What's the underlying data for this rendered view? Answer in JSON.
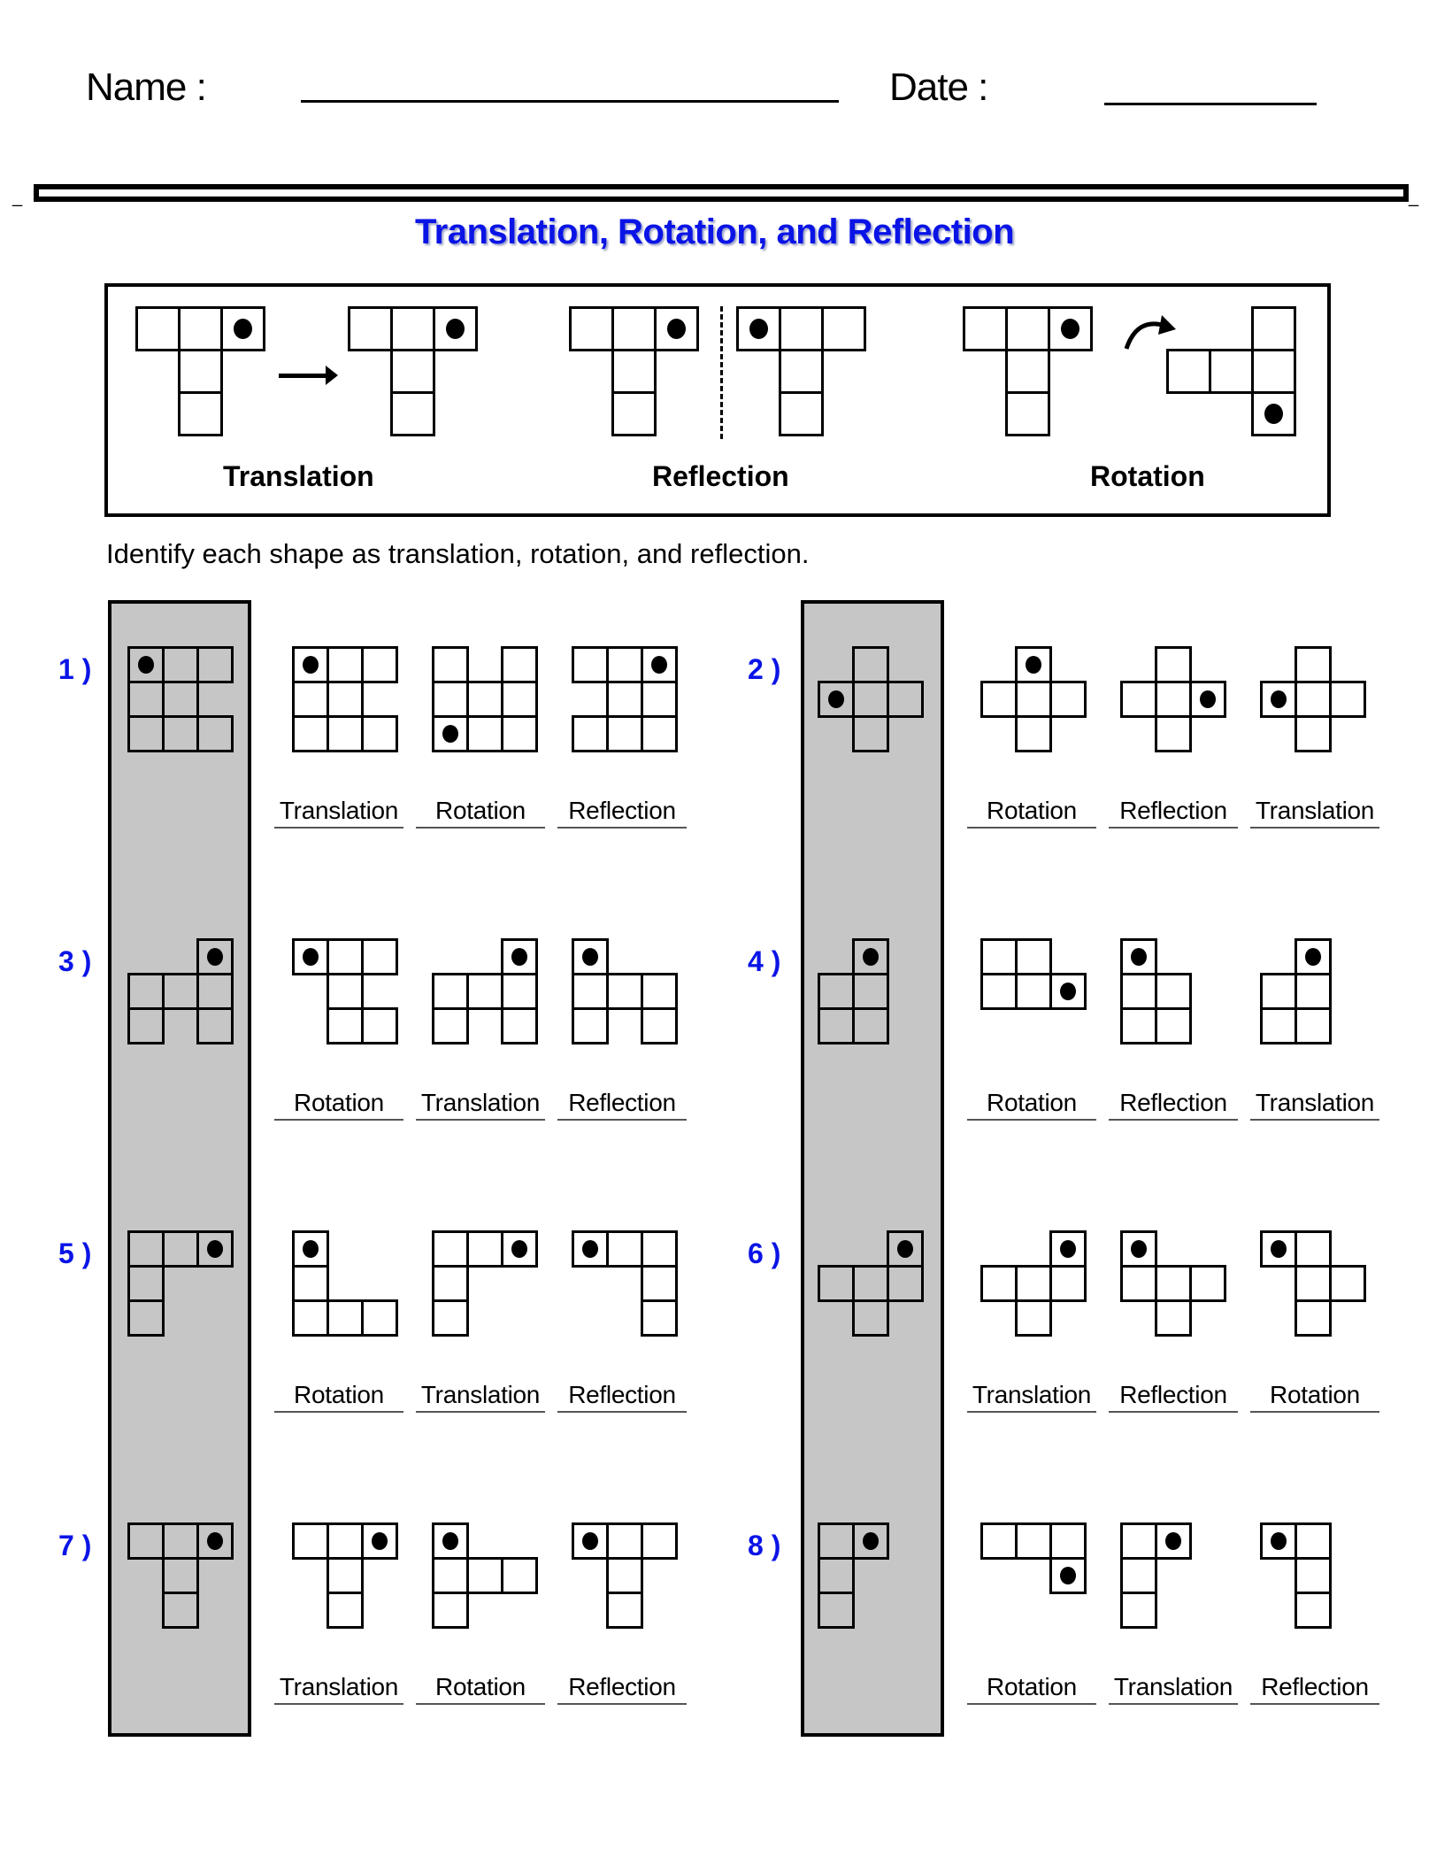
{
  "header": {
    "name_label": "Name :",
    "date_label": "Date :"
  },
  "title": "Translation, Rotation, and Reflection",
  "examples": {
    "translation_label": "Translation",
    "reflection_label": "Reflection",
    "rotation_label": "Rotation"
  },
  "instruction": "Identify each shape as translation, rotation, and reflection.",
  "colors": {
    "accent_blue": "#0a14e6",
    "panel_gray": "#c6c6c6"
  },
  "problems": [
    {
      "number": "1 )",
      "original": {
        "cells": [
          [
            0,
            0
          ],
          [
            0,
            1
          ],
          [
            0,
            2
          ],
          [
            1,
            0
          ],
          [
            1,
            1
          ],
          [
            2,
            0
          ],
          [
            2,
            1
          ],
          [
            2,
            2
          ]
        ],
        "dot": [
          0,
          0
        ]
      },
      "options": [
        {
          "label": "Translation",
          "cells": [
            [
              0,
              0
            ],
            [
              0,
              1
            ],
            [
              0,
              2
            ],
            [
              1,
              0
            ],
            [
              1,
              1
            ],
            [
              2,
              0
            ],
            [
              2,
              1
            ],
            [
              2,
              2
            ]
          ],
          "dot": [
            0,
            0
          ]
        },
        {
          "label": "Rotation",
          "cells": [
            [
              0,
              0
            ],
            [
              0,
              2
            ],
            [
              1,
              0
            ],
            [
              1,
              1
            ],
            [
              1,
              2
            ],
            [
              2,
              0
            ],
            [
              2,
              1
            ],
            [
              2,
              2
            ]
          ],
          "dot": [
            2,
            0
          ]
        },
        {
          "label": "Reflection",
          "cells": [
            [
              0,
              0
            ],
            [
              0,
              1
            ],
            [
              0,
              2
            ],
            [
              1,
              1
            ],
            [
              1,
              2
            ],
            [
              2,
              0
            ],
            [
              2,
              1
            ],
            [
              2,
              2
            ]
          ],
          "dot": [
            0,
            2
          ]
        }
      ]
    },
    {
      "number": "2 )",
      "original": {
        "cells": [
          [
            0,
            1
          ],
          [
            1,
            0
          ],
          [
            1,
            1
          ],
          [
            1,
            2
          ],
          [
            2,
            1
          ]
        ],
        "dot": [
          1,
          0
        ]
      },
      "options": [
        {
          "label": "Rotation",
          "cells": [
            [
              0,
              1
            ],
            [
              1,
              0
            ],
            [
              1,
              1
            ],
            [
              1,
              2
            ],
            [
              2,
              1
            ]
          ],
          "dot": [
            0,
            1
          ]
        },
        {
          "label": "Reflection",
          "cells": [
            [
              0,
              1
            ],
            [
              1,
              0
            ],
            [
              1,
              1
            ],
            [
              1,
              2
            ],
            [
              2,
              1
            ]
          ],
          "dot": [
            1,
            2
          ]
        },
        {
          "label": "Translation",
          "cells": [
            [
              0,
              1
            ],
            [
              1,
              0
            ],
            [
              1,
              1
            ],
            [
              1,
              2
            ],
            [
              2,
              1
            ]
          ],
          "dot": [
            1,
            0
          ]
        }
      ]
    },
    {
      "number": "3 )",
      "original": {
        "cells": [
          [
            0,
            2
          ],
          [
            1,
            0
          ],
          [
            1,
            1
          ],
          [
            1,
            2
          ],
          [
            2,
            0
          ],
          [
            2,
            2
          ]
        ],
        "dot": [
          0,
          2
        ]
      },
      "options": [
        {
          "label": "Rotation",
          "cells": [
            [
              0,
              0
            ],
            [
              0,
              1
            ],
            [
              0,
              2
            ],
            [
              1,
              1
            ],
            [
              2,
              1
            ],
            [
              2,
              2
            ]
          ],
          "dot": [
            0,
            0
          ]
        },
        {
          "label": "Translation",
          "cells": [
            [
              0,
              2
            ],
            [
              1,
              0
            ],
            [
              1,
              1
            ],
            [
              1,
              2
            ],
            [
              2,
              0
            ],
            [
              2,
              2
            ]
          ],
          "dot": [
            0,
            2
          ]
        },
        {
          "label": "Reflection",
          "cells": [
            [
              0,
              0
            ],
            [
              1,
              0
            ],
            [
              1,
              1
            ],
            [
              1,
              2
            ],
            [
              2,
              0
            ],
            [
              2,
              2
            ]
          ],
          "dot": [
            0,
            0
          ]
        }
      ]
    },
    {
      "number": "4 )",
      "original": {
        "cells": [
          [
            0,
            1
          ],
          [
            1,
            0
          ],
          [
            1,
            1
          ],
          [
            2,
            0
          ],
          [
            2,
            1
          ]
        ],
        "dot": [
          0,
          1
        ]
      },
      "options": [
        {
          "label": "Rotation",
          "cells": [
            [
              0,
              0
            ],
            [
              0,
              1
            ],
            [
              1,
              0
            ],
            [
              1,
              1
            ],
            [
              1,
              2
            ]
          ],
          "dot": [
            1,
            2
          ]
        },
        {
          "label": "Reflection",
          "cells": [
            [
              0,
              0
            ],
            [
              1,
              0
            ],
            [
              1,
              1
            ],
            [
              2,
              0
            ],
            [
              2,
              1
            ]
          ],
          "dot": [
            0,
            0
          ]
        },
        {
          "label": "Translation",
          "cells": [
            [
              0,
              1
            ],
            [
              1,
              0
            ],
            [
              1,
              1
            ],
            [
              2,
              0
            ],
            [
              2,
              1
            ]
          ],
          "dot": [
            0,
            1
          ]
        }
      ]
    },
    {
      "number": "5 )",
      "original": {
        "cells": [
          [
            0,
            0
          ],
          [
            0,
            1
          ],
          [
            0,
            2
          ],
          [
            1,
            0
          ],
          [
            2,
            0
          ]
        ],
        "dot": [
          0,
          2
        ]
      },
      "options": [
        {
          "label": "Rotation",
          "cells": [
            [
              0,
              0
            ],
            [
              1,
              0
            ],
            [
              2,
              0
            ],
            [
              2,
              1
            ],
            [
              2,
              2
            ]
          ],
          "dot": [
            0,
            0
          ]
        },
        {
          "label": "Translation",
          "cells": [
            [
              0,
              0
            ],
            [
              0,
              1
            ],
            [
              0,
              2
            ],
            [
              1,
              0
            ],
            [
              2,
              0
            ]
          ],
          "dot": [
            0,
            2
          ]
        },
        {
          "label": "Reflection",
          "cells": [
            [
              0,
              0
            ],
            [
              0,
              1
            ],
            [
              0,
              2
            ],
            [
              1,
              2
            ],
            [
              2,
              2
            ]
          ],
          "dot": [
            0,
            0
          ]
        }
      ]
    },
    {
      "number": "6 )",
      "original": {
        "cells": [
          [
            0,
            2
          ],
          [
            1,
            0
          ],
          [
            1,
            1
          ],
          [
            1,
            2
          ],
          [
            2,
            1
          ]
        ],
        "dot": [
          0,
          2
        ]
      },
      "options": [
        {
          "label": "Translation",
          "cells": [
            [
              0,
              2
            ],
            [
              1,
              0
            ],
            [
              1,
              1
            ],
            [
              1,
              2
            ],
            [
              2,
              1
            ]
          ],
          "dot": [
            0,
            2
          ]
        },
        {
          "label": "Reflection",
          "cells": [
            [
              0,
              0
            ],
            [
              1,
              0
            ],
            [
              1,
              1
            ],
            [
              1,
              2
            ],
            [
              2,
              1
            ]
          ],
          "dot": [
            0,
            0
          ]
        },
        {
          "label": "Rotation",
          "cells": [
            [
              0,
              0
            ],
            [
              0,
              1
            ],
            [
              1,
              1
            ],
            [
              1,
              2
            ],
            [
              2,
              1
            ]
          ],
          "dot": [
            0,
            0
          ]
        }
      ]
    },
    {
      "number": "7 )",
      "original": {
        "cells": [
          [
            0,
            0
          ],
          [
            0,
            1
          ],
          [
            0,
            2
          ],
          [
            1,
            1
          ],
          [
            2,
            1
          ]
        ],
        "dot": [
          0,
          2
        ]
      },
      "options": [
        {
          "label": "Translation",
          "cells": [
            [
              0,
              0
            ],
            [
              0,
              1
            ],
            [
              0,
              2
            ],
            [
              1,
              1
            ],
            [
              2,
              1
            ]
          ],
          "dot": [
            0,
            2
          ]
        },
        {
          "label": "Rotation",
          "cells": [
            [
              0,
              0
            ],
            [
              1,
              0
            ],
            [
              1,
              1
            ],
            [
              1,
              2
            ],
            [
              2,
              0
            ]
          ],
          "dot": [
            0,
            0
          ]
        },
        {
          "label": "Reflection",
          "cells": [
            [
              0,
              0
            ],
            [
              0,
              1
            ],
            [
              0,
              2
            ],
            [
              1,
              1
            ],
            [
              2,
              1
            ]
          ],
          "dot": [
            0,
            0
          ]
        }
      ]
    },
    {
      "number": "8 )",
      "original": {
        "cells": [
          [
            0,
            0
          ],
          [
            0,
            1
          ],
          [
            1,
            0
          ],
          [
            2,
            0
          ]
        ],
        "dot": [
          0,
          1
        ]
      },
      "options": [
        {
          "label": "Rotation",
          "cells": [
            [
              0,
              0
            ],
            [
              0,
              1
            ],
            [
              0,
              2
            ],
            [
              1,
              2
            ]
          ],
          "dot": [
            1,
            2
          ]
        },
        {
          "label": "Translation",
          "cells": [
            [
              0,
              0
            ],
            [
              0,
              1
            ],
            [
              1,
              0
            ],
            [
              2,
              0
            ]
          ],
          "dot": [
            0,
            1
          ]
        },
        {
          "label": "Reflection",
          "cells": [
            [
              0,
              0
            ],
            [
              0,
              1
            ],
            [
              1,
              1
            ],
            [
              2,
              1
            ]
          ],
          "dot": [
            0,
            0
          ]
        }
      ]
    }
  ]
}
